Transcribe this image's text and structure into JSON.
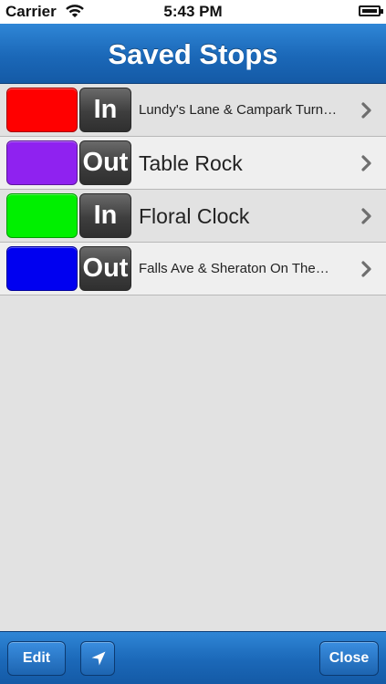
{
  "status_bar": {
    "carrier": "Carrier",
    "time": "5:43 PM",
    "wifi_icon": "wifi-icon",
    "battery_icon": "battery-icon"
  },
  "nav": {
    "title": "Saved Stops"
  },
  "stops": [
    {
      "color": "#ff0000",
      "direction": "In",
      "name": "Lundy's Lane & Campark Turn…",
      "size": "small"
    },
    {
      "color": "#8f22f0",
      "direction": "Out",
      "name": "Table Rock",
      "size": "large"
    },
    {
      "color": "#00f000",
      "direction": "In",
      "name": "Floral Clock",
      "size": "large"
    },
    {
      "color": "#0000f0",
      "direction": "Out",
      "name": "Falls Ave & Sheraton On The…",
      "size": "small"
    }
  ],
  "toolbar": {
    "edit_label": "Edit",
    "location_icon": "location-arrow-icon",
    "close_label": "Close"
  }
}
